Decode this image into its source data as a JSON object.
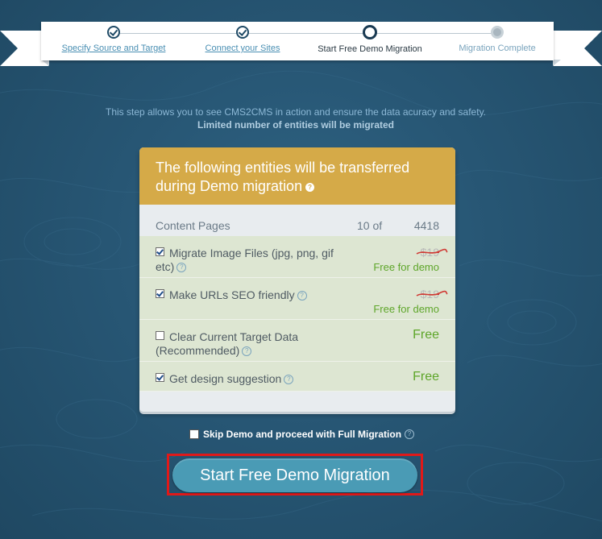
{
  "wizard": {
    "steps": [
      {
        "label": "Specify Source and Target",
        "state": "done"
      },
      {
        "label": "Connect your Sites",
        "state": "done"
      },
      {
        "label": "Start Free Demo Migration",
        "state": "current"
      },
      {
        "label": "Migration Complete",
        "state": "future"
      }
    ]
  },
  "intro": {
    "line1": "This step allows you to see CMS2CMS in action and ensure the data acuracy and safety.",
    "line2": "Limited number of entities will be migrated"
  },
  "card": {
    "title": "The following entities will be transferred during Demo migration",
    "help_icon": "?",
    "content_pages": {
      "label": "Content Pages",
      "count": "10 of",
      "total": "4418"
    },
    "options": [
      {
        "label": "Migrate Image Files (jpg, png, gif etc)",
        "checked": true,
        "old_price": "$19",
        "price_note": "Free for demo"
      },
      {
        "label": "Make URLs SEO friendly",
        "checked": true,
        "old_price": "$19",
        "price_note": "Free for demo"
      },
      {
        "label": "Clear Current Target Data (Recommended)",
        "checked": false,
        "price": "Free"
      },
      {
        "label": "Get design suggestion",
        "checked": true,
        "price": "Free"
      }
    ]
  },
  "skip": {
    "label": "Skip Demo and proceed with Full Migration",
    "checked": false
  },
  "cta": {
    "label": "Start Free Demo Migration"
  },
  "colors": {
    "background": "#275674",
    "header_gold": "#d5aa48",
    "row_green": "#dde6d2",
    "free_green": "#5ea62a",
    "button_blue": "#4a9bb5",
    "highlight_red": "#e01919"
  }
}
